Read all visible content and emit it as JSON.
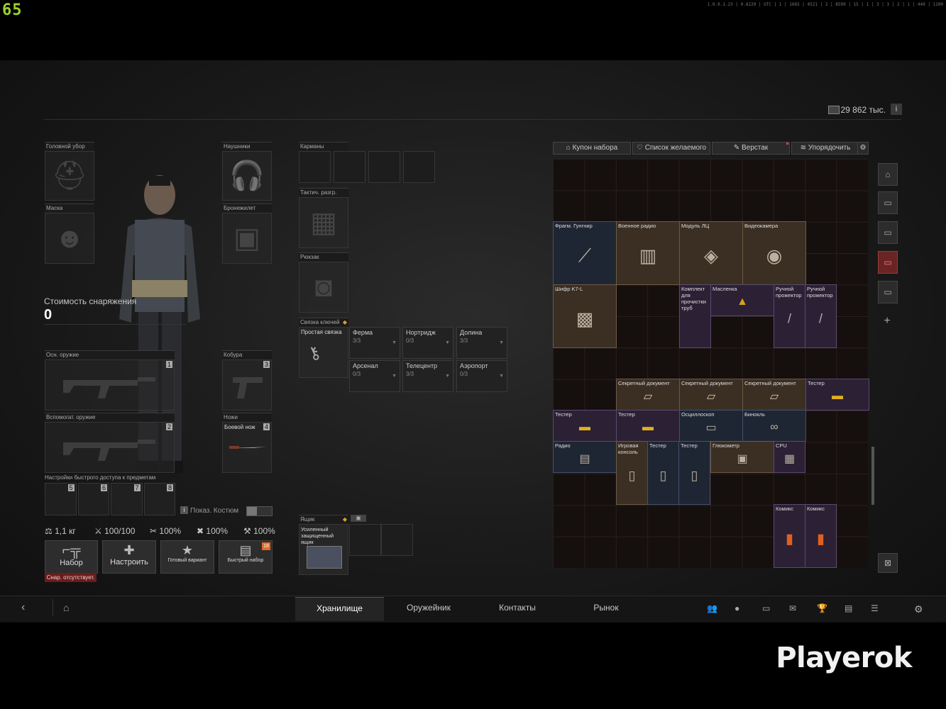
{
  "overlay": {
    "fps": "65",
    "debug_text": "1.0.0.1.23 | 0.8229 | UTC | 1 | 1665 | 4521 | 2 | 8599 | 15 | 1 | 3 | 3 | 2 | 1 | 449 | 1100"
  },
  "header": {
    "money": "29 862 тыс.",
    "info": "i"
  },
  "equipment": {
    "headwear": "Головной убор",
    "headphones": "Наушники",
    "mask": "Маска",
    "armor": "Бронежилет",
    "cost_label": "Стоимость снаряжения",
    "cost_value": "0",
    "primary": "Осн. оружие",
    "primary_num": "1",
    "holster": "Кобура",
    "holster_num": "3",
    "secondary": "Вспомогат. оружие",
    "secondary_num": "2",
    "knives": "Ножи",
    "knife_item": "Боевой нож",
    "knife_num": "4",
    "quick_access": "Настройки быстрого доступа к предметам",
    "quick_slots": [
      "5",
      "6",
      "7",
      "8"
    ],
    "show_costume": "Показ. Костюм"
  },
  "stats": {
    "weight": "1,1 кг",
    "durability": "100/100",
    "s1": "100%",
    "s2": "100%",
    "s3": "100%"
  },
  "buttons": {
    "kit": "Набор",
    "kit_missing": "Снар. отсутствует.",
    "customize": "Настроить",
    "ready": "Готовый вариант",
    "quick_kit": "Быстрый набор",
    "quick_badge": "18"
  },
  "mid": {
    "pockets": "Карманы",
    "rig": "Тактич. разгр.",
    "backpack": "Рюкзак",
    "keyring": "Связка ключей",
    "keyring_item": "Простая связка",
    "keys": [
      {
        "name": "Ферма",
        "count": "3/3"
      },
      {
        "name": "Нортридж",
        "count": "0/3"
      },
      {
        "name": "Долина",
        "count": "3/3"
      },
      {
        "name": "Арсенал",
        "count": "0/3"
      },
      {
        "name": "Телецентр",
        "count": "3/3"
      },
      {
        "name": "Аэропорт",
        "count": "0/3"
      }
    ],
    "box": "Ящик",
    "box_item": "Усиленный защищенный ящик"
  },
  "stash_toolbar": {
    "coupon": "Купон набора",
    "wishlist": "Список желаемого",
    "workbench": "Верстак",
    "sort": "Упорядочить"
  },
  "items": {
    "i1": "Фрагм. Гунгнир",
    "i2": "Военное радио",
    "i3": "Модуль ЛЦ",
    "i4": "Видеокамера",
    "i5": "Шифр K7-L",
    "i6": "Комплект для прочистки труб",
    "i7": "Масленка",
    "i8": "Ручной прожектор",
    "i9": "Ручной прожектор",
    "i10": "Секретный документ",
    "i11": "Секретный документ",
    "i12": "Секретный документ",
    "i13": "Тестер",
    "i14": "Тестер",
    "i15": "Тестер",
    "i16": "Осциллоскоп",
    "i17": "Бинокль",
    "i18": "Радио",
    "i19": "Игровая консоль",
    "i20": "Тестер",
    "i21": "Тестер",
    "i22": "Глюкометр",
    "i23": "CPU",
    "i24": "Комикс",
    "i25": "Комикс"
  },
  "nav": {
    "tabs": [
      "Хранилище",
      "Оружейник",
      "Контакты",
      "Рынок"
    ],
    "active": "Хранилище"
  },
  "watermark": "Playerok"
}
